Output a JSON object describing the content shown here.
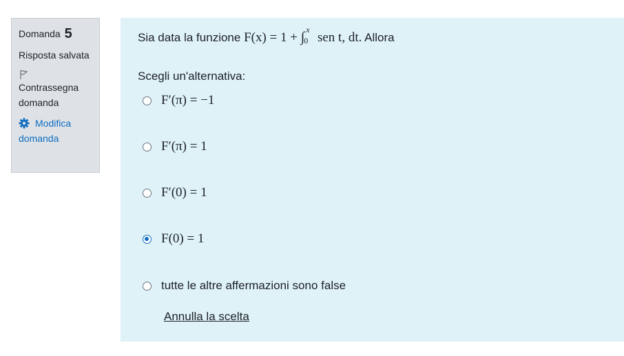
{
  "info": {
    "question_label": "Domanda",
    "question_number": "5",
    "state": "Risposta salvata",
    "flag_label": "Contrassegna domanda",
    "edit_label": "Modifica domanda"
  },
  "question": {
    "text_prefix": "Sia data la funzione",
    "formula_lhs": "F(x) = 1 +",
    "integral_symbol": "∫",
    "integral_upper": "x",
    "integral_lower": "0",
    "integrand": "sen t, dt.",
    "text_suffix": "Allora",
    "prompt": "Scegli un'alternativa:",
    "options": [
      {
        "label": "F′(π) = −1",
        "selected": false
      },
      {
        "label": "F′(π) = 1",
        "selected": false
      },
      {
        "label": "F′(0) = 1",
        "selected": false
      },
      {
        "label": "F(0) = 1",
        "selected": true
      },
      {
        "label": "tutte le altre affermazioni sono false",
        "selected": false
      }
    ],
    "clear_label": "Annulla la scelta"
  },
  "colors": {
    "accent": "#0f6cbf",
    "info_bg": "#dee2e6",
    "content_bg": "#def2f8"
  },
  "icons": {
    "flag": "flag-icon",
    "edit": "gear-icon"
  }
}
